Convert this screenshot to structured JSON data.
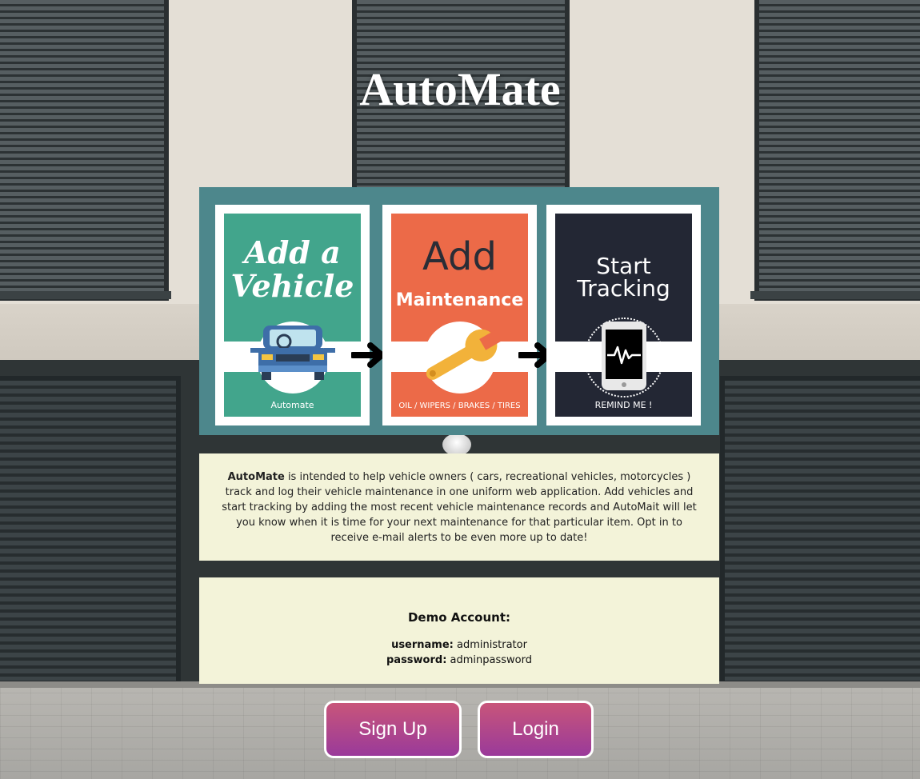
{
  "app": {
    "title": "AutoMate"
  },
  "steps": [
    {
      "heading_lines": [
        "Add a",
        "Vehicle"
      ],
      "caption": "Automate",
      "color": "#42a58c",
      "icon": "car-icon"
    },
    {
      "heading_line1": "Add",
      "heading_line2": "Maintenance",
      "caption": "OIL / WIPERS / BRAKES / TIRES",
      "color": "#ec6a48",
      "icon": "wrench-icon"
    },
    {
      "heading_lines": [
        "Start",
        "Tracking"
      ],
      "caption": "REMIND ME !",
      "color": "#232734",
      "icon": "phone-heartbeat-icon"
    }
  ],
  "description": {
    "brand": "AutoMate",
    "text": " is intended to help vehicle owners ( cars, recreational vehicles, motorcycles ) track and log their vehicle maintenance in one uniform web application. Add vehicles and start tracking by adding the most recent vehicle maintenance records and AutoMait will let you know when it is time for your next maintenance for that particular item. Opt in to receive e-mail alerts to be even more up to date!"
  },
  "demo": {
    "heading": "Demo Account:",
    "username_label": "username:",
    "username_value": " administrator",
    "password_label": "password:",
    "password_value": " adminpassword"
  },
  "buttons": {
    "signup": "Sign Up",
    "login": "Login"
  },
  "colors": {
    "banner": "#4d878c",
    "panel": "#f3f3d9",
    "button_top": "#c8557a",
    "button_bottom": "#9a3a9a"
  }
}
